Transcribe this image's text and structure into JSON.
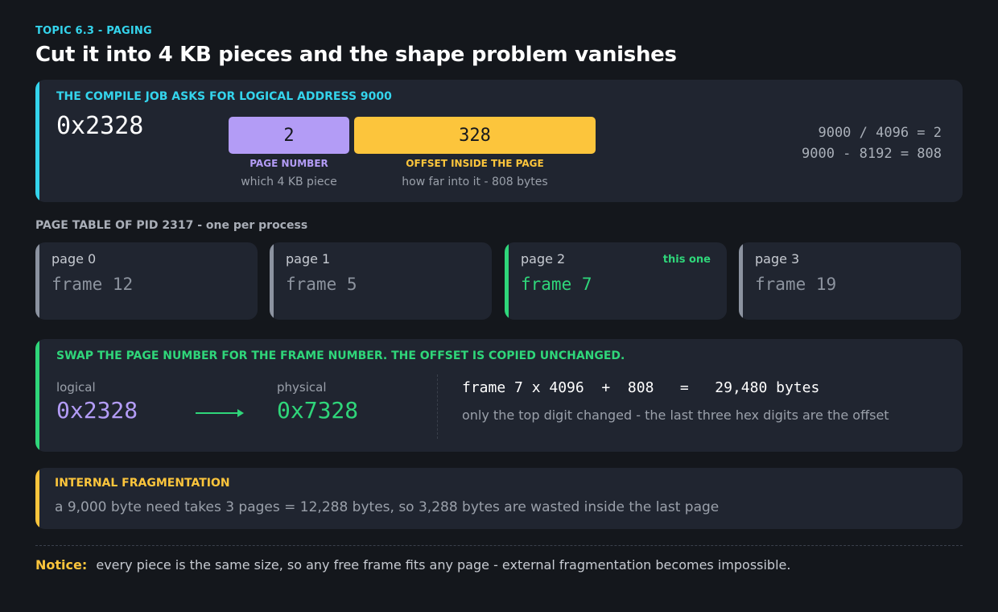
{
  "header": {
    "topic": "TOPIC 6.3  -  PAGING",
    "title": "Cut it into 4 KB pieces and the shape problem vanishes"
  },
  "address": {
    "heading": "THE COMPILE JOB ASKS FOR LOGICAL ADDRESS 9000",
    "hex": "0x2328",
    "page_value": "2",
    "offset_value": "328",
    "page_label": "PAGE NUMBER",
    "page_sub": "which 4 KB piece",
    "offset_label": "OFFSET INSIDE THE PAGE",
    "offset_sub": "how far into it  -  808 bytes",
    "calc_line1": "9000 / 4096 = 2",
    "calc_line2": "9000 - 8192 = 808"
  },
  "page_table": {
    "label": "PAGE TABLE OF PID 2317  -  one per process",
    "entries": [
      {
        "page": "page 0",
        "frame": "frame 12"
      },
      {
        "page": "page 1",
        "frame": "frame 5"
      },
      {
        "page": "page 2",
        "frame": "frame 7",
        "tag": "this one"
      },
      {
        "page": "page 3",
        "frame": "frame 19"
      }
    ]
  },
  "swap": {
    "heading": "SWAP THE PAGE NUMBER FOR THE FRAME NUMBER. THE OFFSET IS COPIED UNCHANGED.",
    "logical_label": "logical",
    "logical_hex": "0x2328",
    "physical_label": "physical",
    "physical_hex": "0x7328",
    "formula": "frame 7 x 4096  +  808   =   29,480 bytes",
    "note": "only the top digit changed  -  the last three hex digits are the offset"
  },
  "fragmentation": {
    "heading": "INTERNAL FRAGMENTATION",
    "text": "a 9,000 byte need takes 3 pages = 12,288 bytes, so 3,288 bytes are wasted inside the last page"
  },
  "notice": {
    "key": "Notice:",
    "text": "every piece is the same size, so any free frame fits any page - external fragmentation becomes impossible."
  },
  "colors": {
    "cyan": "#34d4ec",
    "purple": "#b39cf6",
    "yellow": "#fcc53c",
    "green": "#2fd67a",
    "gray_accent": "#8c93a0"
  }
}
